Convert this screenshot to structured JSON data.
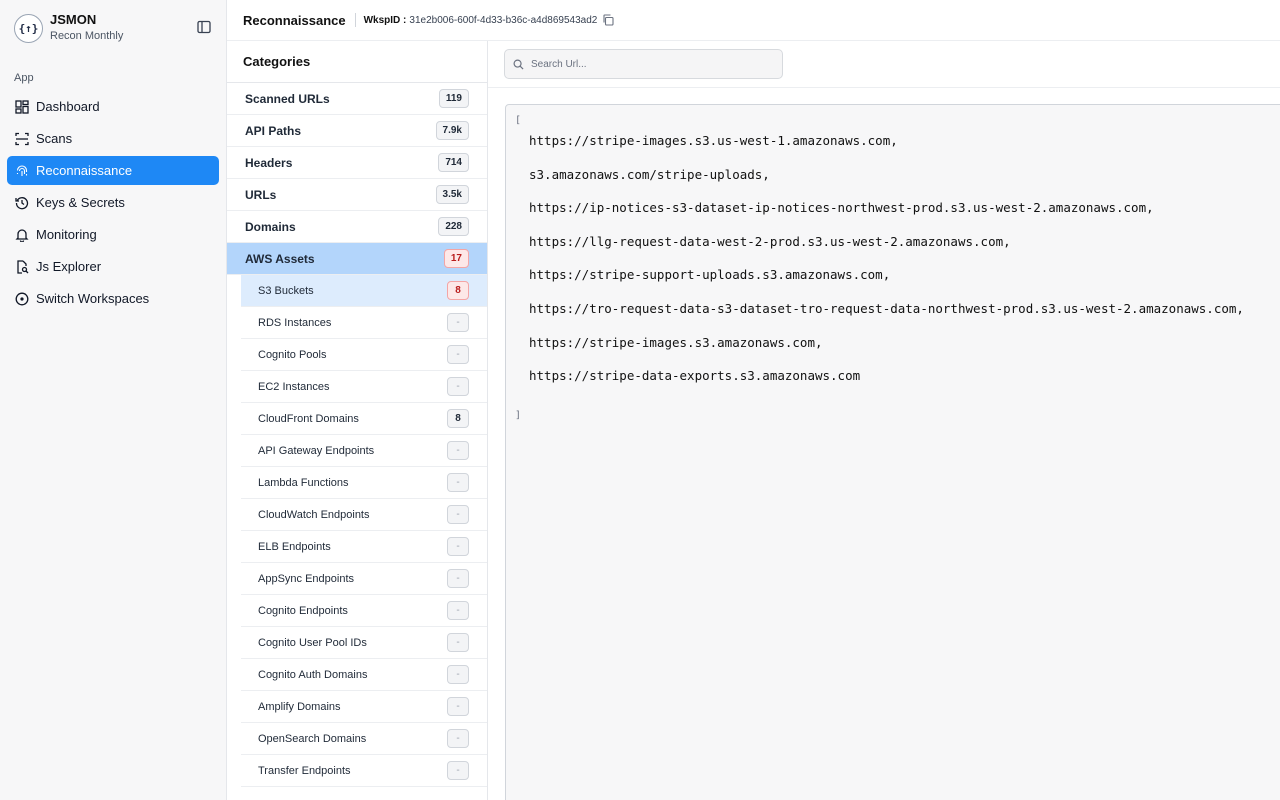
{
  "brand": {
    "name": "JSMON",
    "subtitle": "Recon Monthly",
    "logo_text": "{↑}"
  },
  "sidebar": {
    "section_label": "App",
    "items": [
      {
        "label": "Dashboard",
        "icon": "dashboard-icon"
      },
      {
        "label": "Scans",
        "icon": "scan-icon"
      },
      {
        "label": "Reconnaissance",
        "icon": "fingerprint-icon",
        "active": true
      },
      {
        "label": "Keys & Secrets",
        "icon": "key-history-icon"
      },
      {
        "label": "Monitoring",
        "icon": "bell-icon"
      },
      {
        "label": "Js Explorer",
        "icon": "file-search-icon"
      },
      {
        "label": "Switch Workspaces",
        "icon": "circle-dot-icon"
      }
    ]
  },
  "header": {
    "title": "Reconnaissance",
    "wksp_label": "WkspID :",
    "wksp_id": "31e2b006-600f-4d33-b36c-a4d869543ad2"
  },
  "categories": {
    "title": "Categories",
    "rows": [
      {
        "label": "Scanned URLs",
        "count": "119"
      },
      {
        "label": "API Paths",
        "count": "7.9k"
      },
      {
        "label": "Headers",
        "count": "714"
      },
      {
        "label": "URLs",
        "count": "3.5k"
      },
      {
        "label": "Domains",
        "count": "228"
      },
      {
        "label": "AWS Assets",
        "count": "17"
      }
    ],
    "sub_rows": [
      {
        "label": "S3 Buckets",
        "count": "8"
      },
      {
        "label": "RDS Instances",
        "count": "-"
      },
      {
        "label": "Cognito Pools",
        "count": "-"
      },
      {
        "label": "EC2 Instances",
        "count": "-"
      },
      {
        "label": "CloudFront Domains",
        "count": "8"
      },
      {
        "label": "API Gateway Endpoints",
        "count": "-"
      },
      {
        "label": "Lambda Functions",
        "count": "-"
      },
      {
        "label": "CloudWatch Endpoints",
        "count": "-"
      },
      {
        "label": "ELB Endpoints",
        "count": "-"
      },
      {
        "label": "AppSync Endpoints",
        "count": "-"
      },
      {
        "label": "Cognito Endpoints",
        "count": "-"
      },
      {
        "label": "Cognito User Pool IDs",
        "count": "-"
      },
      {
        "label": "Cognito Auth Domains",
        "count": "-"
      },
      {
        "label": "Amplify Domains",
        "count": "-"
      },
      {
        "label": "OpenSearch Domains",
        "count": "-"
      },
      {
        "label": "Transfer Endpoints",
        "count": "-"
      }
    ]
  },
  "search": {
    "placeholder": "Search Url..."
  },
  "results": {
    "open_bracket": "[",
    "close_bracket": "]",
    "urls": [
      "https://stripe-images.s3.us-west-1.amazonaws.com,",
      "s3.amazonaws.com/stripe-uploads,",
      "https://ip-notices-s3-dataset-ip-notices-northwest-prod.s3.us-west-2.amazonaws.com,",
      "https://llg-request-data-west-2-prod.s3.us-west-2.amazonaws.com,",
      "https://stripe-support-uploads.s3.amazonaws.com,",
      "https://tro-request-data-s3-dataset-tro-request-data-northwest-prod.s3.us-west-2.amazonaws.com,",
      "https://stripe-images.s3.amazonaws.com,",
      "https://stripe-data-exports.s3.amazonaws.com"
    ]
  },
  "colors": {
    "accent": "#1e88f5",
    "active_row": "#b3d5fb",
    "active_sub_row": "#ddecfd",
    "badge_red": "#b91c1c"
  }
}
